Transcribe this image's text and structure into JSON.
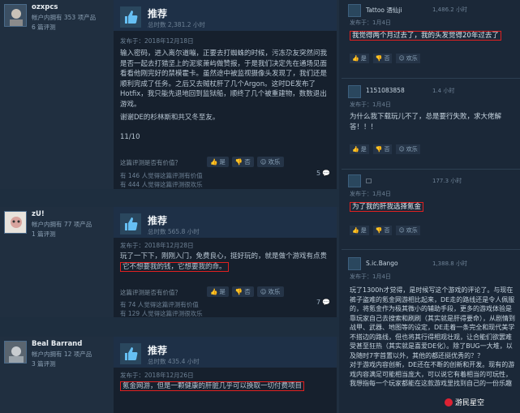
{
  "reviews": [
    {
      "username": "ozxpcs",
      "owned": "帐户内拥有 353 项产品",
      "review_count": "6 篇评测",
      "verdict": "推荐",
      "hours": "总时数 2,381.2 小时",
      "date": "发布于：2018年12月18日",
      "text_lines": [
        "输入密码，进入离尔道嘣，正要去打蜘蛛的时候，污冻尕友突然问我是否一起去打猎坚上的泥浆萧屿做赞报，于是我们决定先在通场见面看看他刚完好的禁模霍卡。虽然途中被监视摄像头发现了，我们还是顺利完成了任务。之后又去贼杖肝了几个Argon。这时DE发布了Hotfix，我只能先退地回到监狱船，顺终了几个被重建物，数数退出游戏。",
        "谢谢DE的杉林斯和共又冬至友。",
        "11/10"
      ],
      "helpful_q": "这篇评测是否有价值？",
      "yes": "是",
      "no": "否",
      "funny": "欢乐",
      "stat1": "有 146 人觉得这篇评测有价值",
      "stat2": "有 444 人觉得这篇评测很欢乐",
      "comments": "5"
    },
    {
      "username": "zU!",
      "owned": "帐户内拥有 77 项产品",
      "review_count": "1 篇评测",
      "verdict": "推荐",
      "hours": "总时数 565.8 小时",
      "date": "发布于：2018年12月28日",
      "text_plain": "玩了一下下，刚刚入门，免费良心，挺好玩的，就是做个游戏有点贵",
      "text_hl": "它不想要我的钱，它想要我的命。",
      "helpful_q": "这篇评测是否有价值？",
      "yes": "是",
      "no": "否",
      "funny": "欢乐",
      "stat1": "有 74 人觉得这篇评测有价值",
      "stat2": "有 129 人觉得这篇评测很欢乐",
      "comments": "7"
    },
    {
      "username": "Beal Barrand",
      "owned": "帐户内拥有 12 项产品",
      "review_count": "3 篇评测",
      "verdict": "推荐",
      "hours": "总时数 435.4 小时",
      "date": "发布于：2018年12月26日",
      "text_hl": "氪金网游，但是一颗健康的肝脏几乎可以换取一切付费项目"
    }
  ],
  "comments": [
    {
      "name": "Tattoo 酒仙ji",
      "hours": "1,486.2 小时",
      "date": "发布于：1月4日",
      "text_hl": "我觉得两个月过去了，我的头发觉得20年过去了",
      "yes": "是",
      "no": "否",
      "funny": "欢乐"
    },
    {
      "name": "1151083858",
      "hours": "1.4 小时",
      "date": "发布于：1月4日",
      "text": "为什么我下载玩儿不了，总是要行失败，求大佬解答！！！",
      "yes": "是",
      "no": "否",
      "funny": "欢乐"
    },
    {
      "name": "□",
      "hours": "177.3 小时",
      "date": "发布于：1月4日",
      "text_hl": "为了我的肝我选择氪金",
      "yes": "是",
      "no": "否",
      "funny": "欢乐"
    },
    {
      "name": "S.ic.Bango",
      "hours": "1,388.8 小时",
      "date": "发布于：1月4日",
      "text": "玩了1300h才觉得，是时候写这个游戏的评论了。与现在裤子盗难的氪金网游相比起来，DE走的路线还是令人佩服的，将氪金作为极其微小的辅助手段，更多的游戏体验是靠玩家自己去搜索和刷刷（其实就是肝得要命），从剧情到战甲、武器、地图等的设定，DE走着一条完全和现代美学不搭边的路线，但也将其行得相观壮观，让合能们欲罢难受甚至狂热（其实就是喜爱DE化）。除了BUG一大堆，以及随时7字首置以外，其他的都还挺优秀的？？\n对于游戏内容创新，DE还在不断的创新和开发。现有的游戏内容满足可能相当庞大，可以说它有着相当的可玩性，我想指每一个玩家都能在这款游戏里找到自己的一份乐趣"
    }
  ],
  "watermark": "游民星空"
}
